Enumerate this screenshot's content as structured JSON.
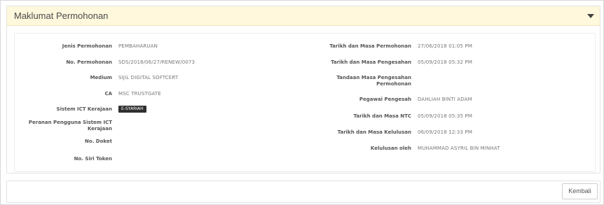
{
  "panel": {
    "title": "Maklumat Permohonan"
  },
  "left": [
    {
      "label": "Jenis Permohonan",
      "value": "PEMBAHARUAN"
    },
    {
      "label": "No. Permohonan",
      "value": "SDS/2018/06/27/RENEW/0073"
    },
    {
      "label": "Medium",
      "value": "SIJIL DIGITAL SOFTCERT"
    },
    {
      "label": "CA",
      "value": "MSC TRUSTGATE"
    },
    {
      "label": "Sistem ICT Kerajaan",
      "badge": "E-SYARIAH"
    },
    {
      "label_line1": "Peranan Pengguna Sistem ICT",
      "label_line2": "Kerajaan",
      "value": ""
    },
    {
      "label": "No. Doket",
      "value": ""
    },
    {
      "label": "No. Siri Token",
      "value": ""
    }
  ],
  "right": [
    {
      "label": "Tarikh dan Masa Permohonan",
      "value": "27/06/2018 01:05 PM"
    },
    {
      "label": "Tarikh dan Masa Pengesahan",
      "value": "05/09/2018 05:32 PM"
    },
    {
      "label_line1": "Tandaan Masa Pengesahan",
      "label_line2": "Permohonan",
      "value": ""
    },
    {
      "label": "Pegawai Pengesah",
      "value": "DAHLIAH BINTI ADAM"
    },
    {
      "label": "Tarikh dan Masa NTC",
      "value": "05/09/2018 05:35 PM"
    },
    {
      "label": "Tarikh dan Masa Kelulusan",
      "value": "06/09/2018 12:33 PM"
    },
    {
      "label": "Kelulusan oleh",
      "value": "MUHAMMAD ASYRIL BIN MINHAT"
    }
  ],
  "footer": {
    "back_label": "Kembali"
  }
}
